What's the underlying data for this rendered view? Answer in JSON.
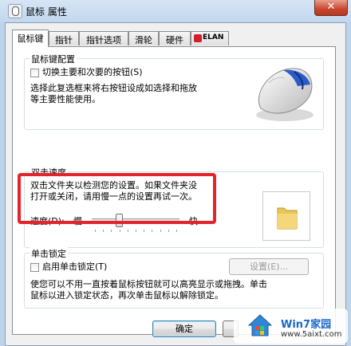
{
  "window": {
    "title": "鼠标 属性",
    "close_label": "✕"
  },
  "tabs": [
    {
      "label": "鼠标键",
      "active": true
    },
    {
      "label": "指针",
      "active": false
    },
    {
      "label": "指针选项",
      "active": false
    },
    {
      "label": "滑轮",
      "active": false
    },
    {
      "label": "硬件",
      "active": false
    },
    {
      "label": "ELAN",
      "active": false
    }
  ],
  "button_config": {
    "title": "鼠标键配置",
    "switch_label": "切换主要和次要的按钮(S)",
    "switch_checked": false,
    "description_line1": "选择此复选框来将右按钮设成如选择和拖放",
    "description_line2": "等主要性能使用。"
  },
  "double_click": {
    "title": "双击速度",
    "description_line1": "双击文件夹以检测您的设置。如果文件夹没",
    "description_line2": "打开或关闭，请用慢一点的设置再试一次。",
    "speed_label": "速度(D):",
    "slow_label": "慢",
    "fast_label": "快",
    "speed_value": 0.3
  },
  "click_lock": {
    "title": "单击锁定",
    "enable_label": "启用单击锁定(T)",
    "enable_checked": false,
    "settings_button": "设置(E)...",
    "description_line1": "使您可以不用一直按着鼠标按钮就可以高亮显示或拖拽。单击",
    "description_line2": "鼠标以进入锁定状态，再次单击鼠标以解除锁定。"
  },
  "footer": {
    "ok_label": "确定"
  },
  "watermark": {
    "brand": "Win7家园",
    "url": "www.5aixt.com"
  },
  "colors": {
    "highlight": "#e3242b",
    "accent_blue": "#1a66c9"
  }
}
